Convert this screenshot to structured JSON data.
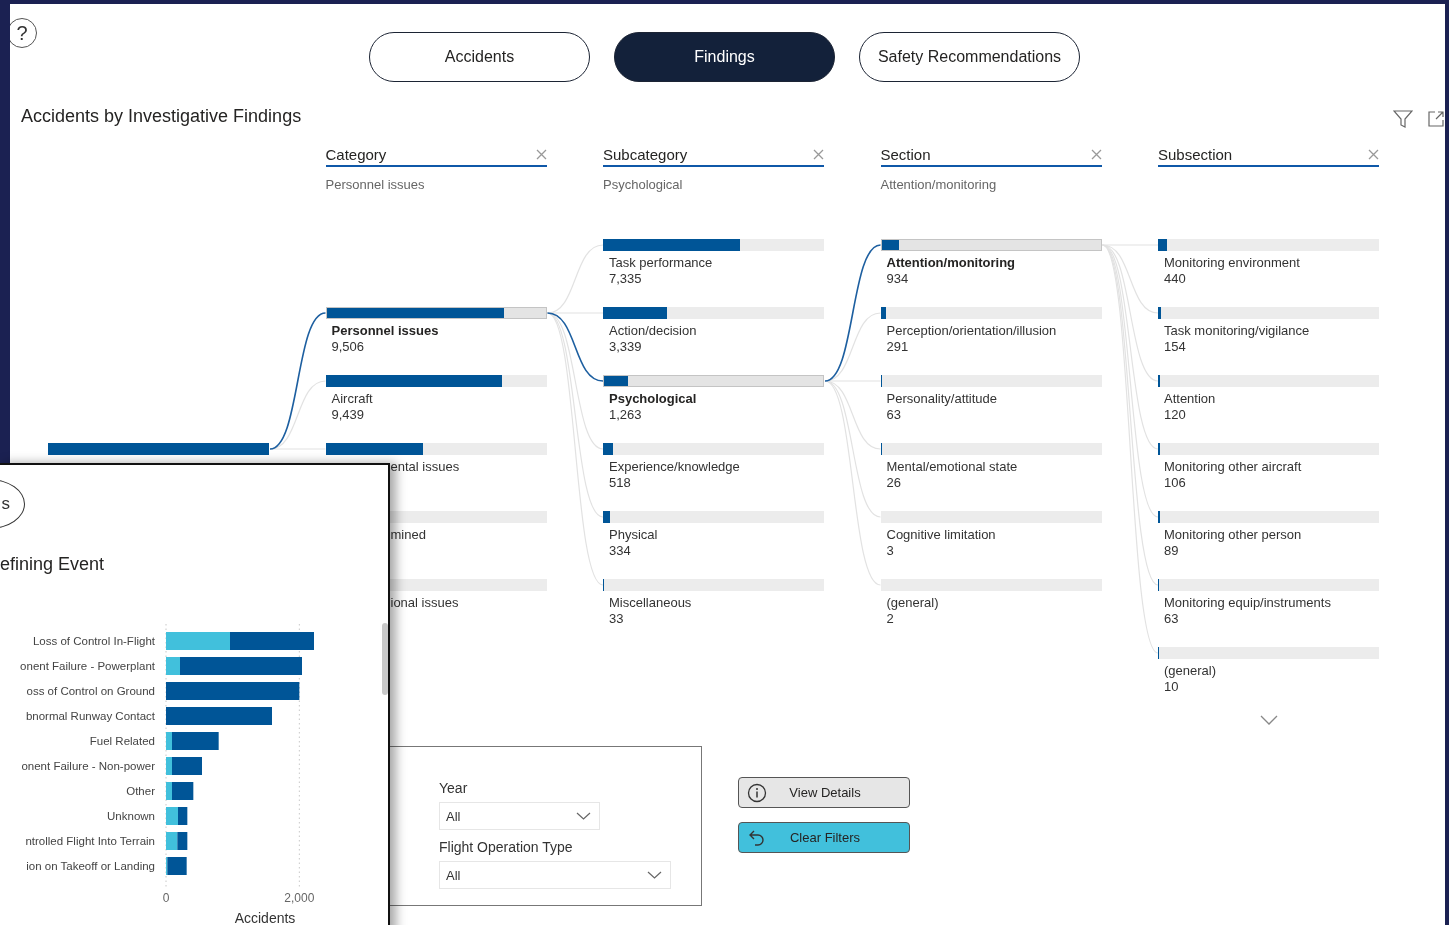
{
  "help_button": {
    "label": "?"
  },
  "tabs": [
    {
      "label": "Accidents",
      "selected": false
    },
    {
      "label": "Findings",
      "selected": true
    },
    {
      "label": "Safety Recommendations",
      "selected": false
    }
  ],
  "tree": {
    "title": "Accidents by Investigative Findings",
    "levels": [
      {
        "name": "Category",
        "filter": "Personnel issues",
        "items": [
          {
            "label": "Personnel issues",
            "value": "9,506",
            "level": 0.81,
            "selected": true,
            "kind": "full"
          },
          {
            "label": "Aircraft",
            "value": "9,439",
            "level": 0.8,
            "selected": false,
            "kind": "full"
          },
          {
            "label": "ental issues",
            "level": 0.44,
            "selected": false,
            "kind": "label_cut"
          },
          {
            "label": "mined",
            "selected": false,
            "kind": "cut"
          },
          {
            "label": "ional issues",
            "selected": false,
            "kind": "cut"
          }
        ]
      },
      {
        "name": "Subcategory",
        "filter": "Psychological",
        "items": [
          {
            "label": "Task performance",
            "value": "7,335",
            "level": 0.62,
            "selected": false
          },
          {
            "label": "Action/decision",
            "value": "3,339",
            "level": 0.29,
            "selected": false
          },
          {
            "label": "Psychological",
            "value": "1,263",
            "level": 0.11,
            "selected": true
          },
          {
            "label": "Experience/knowledge",
            "value": "518",
            "level": 0.045,
            "selected": false
          },
          {
            "label": "Physical",
            "value": "334",
            "level": 0.03,
            "selected": false
          },
          {
            "label": "Miscellaneous",
            "value": "33",
            "level": 0.005,
            "selected": false
          }
        ]
      },
      {
        "name": "Section",
        "filter": "Attention/monitoring",
        "items": [
          {
            "label": "Attention/monitoring",
            "value": "934",
            "level": 0.08,
            "selected": true
          },
          {
            "label": "Perception/orientation/illusion",
            "value": "291",
            "level": 0.025,
            "selected": false
          },
          {
            "label": "Personality/attitude",
            "value": "63",
            "level": 0.006,
            "selected": false
          },
          {
            "label": "Mental/emotional state",
            "value": "26",
            "level": 0.003,
            "selected": false
          },
          {
            "label": "Cognitive limitation",
            "value": "3",
            "selected": false
          },
          {
            "label": "(general)",
            "value": "2",
            "selected": false
          }
        ]
      },
      {
        "name": "Subsection",
        "items": [
          {
            "label": "Monitoring environment",
            "value": "440",
            "level": 0.04,
            "selected": false
          },
          {
            "label": "Task monitoring/vigilance",
            "value": "154",
            "level": 0.013,
            "selected": false
          },
          {
            "label": "Attention",
            "value": "120",
            "level": 0.01,
            "selected": false
          },
          {
            "label": "Monitoring other aircraft",
            "value": "106",
            "level": 0.01,
            "selected": false
          },
          {
            "label": "Monitoring other person",
            "value": "89",
            "level": 0.008,
            "selected": false
          },
          {
            "label": "Monitoring equip/instruments",
            "value": "63",
            "level": 0.006,
            "selected": false
          },
          {
            "label": "(general)",
            "value": "10",
            "level": 0.001,
            "selected": false
          }
        ]
      }
    ]
  },
  "filters": [
    {
      "label": "Year",
      "value": "All"
    },
    {
      "label": "Flight Operation Type",
      "value": "All"
    }
  ],
  "buttons": [
    {
      "label": "View Details",
      "kind": "info"
    },
    {
      "label": "Clear Filters",
      "kind": "reset"
    }
  ],
  "overlay": {
    "button_label": "s",
    "title": "efining Event",
    "chart_data": {
      "type": "bar",
      "orientation": "horizontal",
      "stacked": true,
      "xlabel": "Accidents",
      "xlim": [
        0,
        2250
      ],
      "xticks": [
        0,
        {
          "value": 2000,
          "label": "2,000"
        }
      ],
      "categories": [
        "Loss of Control In-Flight",
        "onent Failure - Powerplant",
        "oss of Control on Ground",
        "bnormal Runway Contact",
        "Fuel Related",
        "onent Failure - Non-power",
        "Other",
        "Unknown",
        "ntrolled Flight Into Terrain",
        "ion on Takeoff or Landing"
      ],
      "series": [
        {
          "color": "#41c0dc",
          "values": [
            960,
            210,
            0,
            0,
            90,
            90,
            90,
            180,
            170,
            20
          ]
        },
        {
          "color": "#005597",
          "values": [
            1260,
            1830,
            2000,
            1590,
            700,
            450,
            320,
            140,
            150,
            290
          ]
        }
      ]
    }
  }
}
